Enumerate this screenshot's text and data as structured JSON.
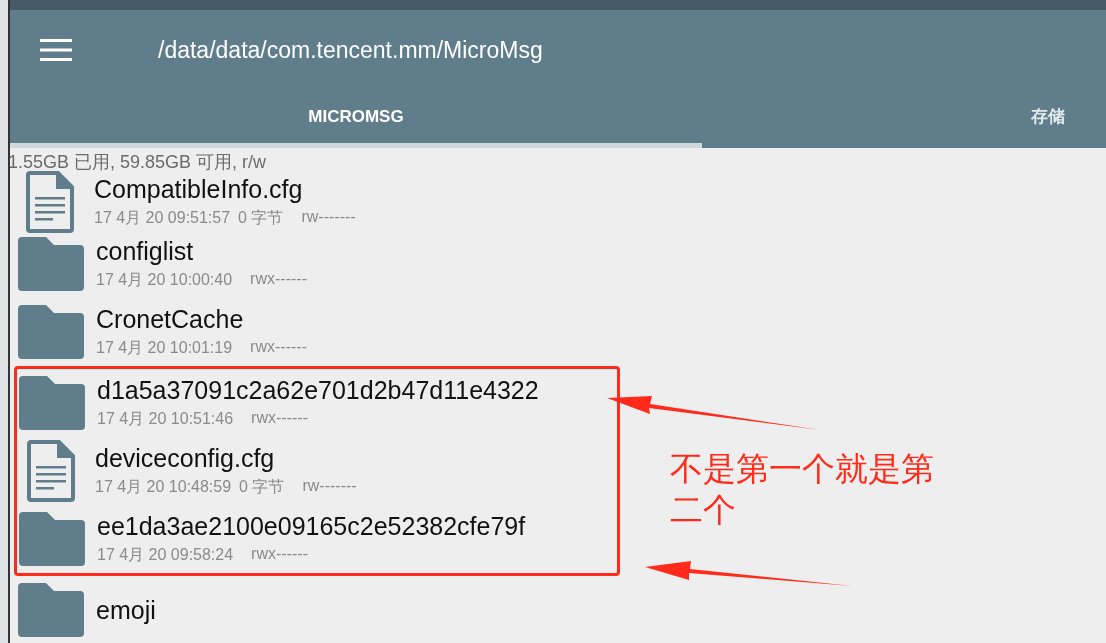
{
  "toolbar": {
    "path": "/data/data/com.tencent.mm/MicroMsg"
  },
  "tabs": [
    {
      "label": "MICROMSG",
      "selected": true
    },
    {
      "label": "存储",
      "selected": false
    }
  ],
  "storage_info": "1.55GB 已用, 59.85GB 可用, r/w",
  "files": [
    {
      "kind": "file",
      "name": "CompatibleInfo.cfg",
      "date": "17 4月 20 09:51:57",
      "size": "0 字节",
      "permissions": "rw-------",
      "highlighted": false
    },
    {
      "kind": "folder",
      "name": "configlist",
      "date": "17 4月 20 10:00:40",
      "permissions": "rwx------",
      "highlighted": false
    },
    {
      "kind": "folder",
      "name": "CronetCache",
      "date": "17 4月 20 10:01:19",
      "permissions": "rwx------",
      "highlighted": false
    },
    {
      "kind": "folder",
      "name": "d1a5a37091c2a62e701d2b47d11e4322",
      "date": "17 4月 20 10:51:46",
      "permissions": "rwx------",
      "highlighted": true
    },
    {
      "kind": "file",
      "name": "deviceconfig.cfg",
      "date": "17 4月 20 10:48:59",
      "size": "0 字节",
      "permissions": "rw-------",
      "highlighted": true
    },
    {
      "kind": "folder",
      "name": "ee1da3ae2100e09165c2e52382cfe79f",
      "date": "17 4月 20 09:58:24",
      "permissions": "rwx------",
      "highlighted": true
    },
    {
      "kind": "folder",
      "name": "emoji",
      "highlighted": false
    }
  ],
  "annotation": {
    "note": "不是第一个就是第二个"
  }
}
